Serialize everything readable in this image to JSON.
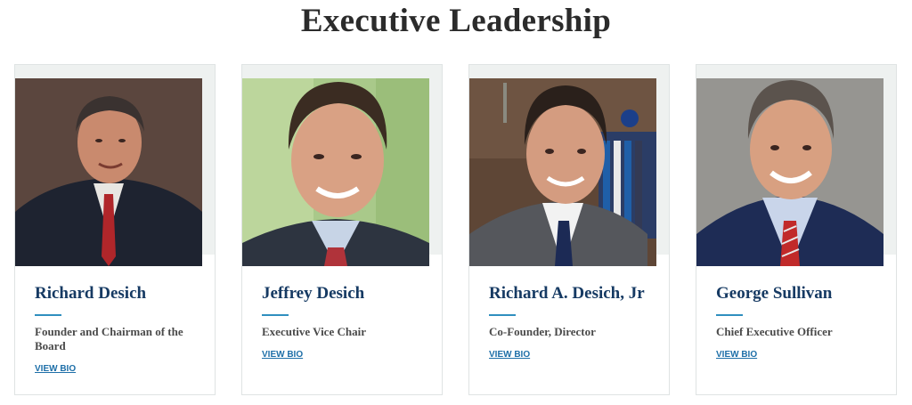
{
  "section": {
    "title": "Executive Leadership"
  },
  "people": [
    {
      "name": "Richard Desich",
      "role": "Founder and Chairman of the Board",
      "link": "VIEW BIO"
    },
    {
      "name": "Jeffrey Desich",
      "role": "Executive Vice Chair",
      "link": "VIEW BIO"
    },
    {
      "name": "Richard A. Desich, Jr",
      "role": "Co-Founder, Director",
      "link": "VIEW BIO"
    },
    {
      "name": "George Sullivan",
      "role": "Chief Executive Officer",
      "link": "VIEW BIO"
    }
  ],
  "colors": {
    "heading": "#2b2b2b",
    "name": "#163a63",
    "accent_rule": "#2f8fbf",
    "link": "#1e6fa8"
  }
}
